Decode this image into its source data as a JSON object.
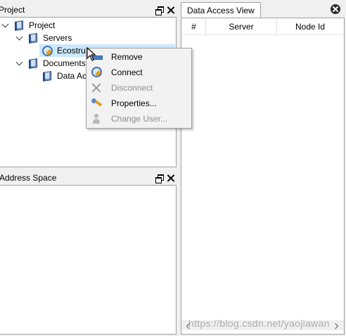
{
  "project_pane": {
    "title": "Project",
    "tree": {
      "root": "Project",
      "servers": "Servers",
      "server_item": "Ecostruxure",
      "documents": "Documents",
      "document_item": "Data Access View"
    }
  },
  "address_pane": {
    "title": "Address Space"
  },
  "data_access_view": {
    "tab_label": "Data Access View",
    "columns": [
      "#",
      "Server",
      "Node Id"
    ]
  },
  "context_menu": {
    "items": [
      {
        "label": "Remove",
        "icon": "remove-icon",
        "enabled": true
      },
      {
        "label": "Connect",
        "icon": "connect-icon",
        "enabled": true
      },
      {
        "label": "Disconnect",
        "icon": "disconnect-icon",
        "enabled": false
      },
      {
        "label": "Properties...",
        "icon": "wrench-icon",
        "enabled": true
      },
      {
        "label": "Change User...",
        "icon": "user-icon",
        "enabled": false
      }
    ]
  },
  "watermark": "https://blog.csdn.net/yaojiawan",
  "colors": {
    "selection": "#cce8ff",
    "panel_bg": "#f0f0f0",
    "disabled_text": "#8d8d8d"
  }
}
